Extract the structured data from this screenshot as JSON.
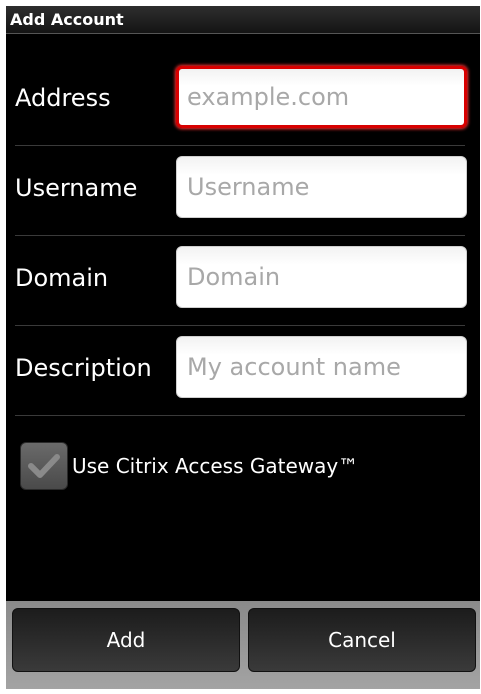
{
  "dialog": {
    "title": "Add Account"
  },
  "form": {
    "address": {
      "label": "Address",
      "placeholder": "example.com",
      "value": ""
    },
    "username": {
      "label": "Username",
      "placeholder": "Username",
      "value": ""
    },
    "domain": {
      "label": "Domain",
      "placeholder": "Domain",
      "value": ""
    },
    "description": {
      "label": "Description",
      "placeholder": "My account name",
      "value": ""
    },
    "gateway": {
      "label": "Use Citrix Access Gateway™",
      "checked": true
    }
  },
  "buttons": {
    "add_label": "Add",
    "cancel_label": "Cancel"
  },
  "icons": {
    "gateway_checkbox": "checkmark-icon"
  },
  "colors": {
    "focus_border": "#d80000",
    "dialog_background": "#000000",
    "button_bar": "#9a9a9a"
  }
}
